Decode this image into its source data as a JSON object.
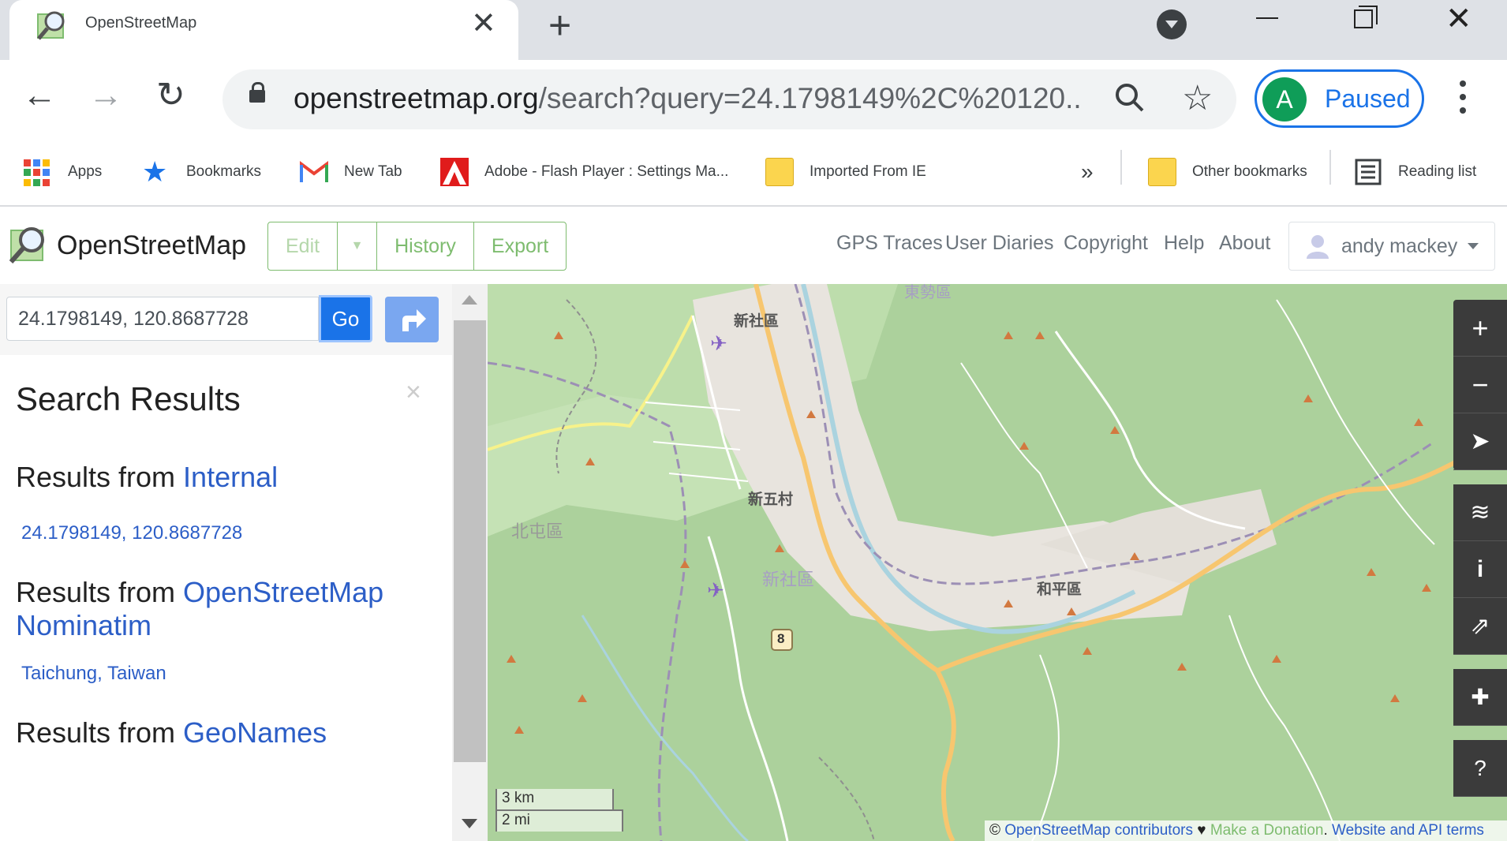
{
  "browser": {
    "tab_title": "OpenStreetMap",
    "url_domain": "openstreetmap.org",
    "url_path": "/search?query=24.1798149%2C%20120....",
    "profile_initial": "A",
    "profile_status": "Paused"
  },
  "bookmarks": [
    {
      "label": "Apps",
      "icon": "apps-grid-icon"
    },
    {
      "label": "Bookmarks",
      "icon": "star-icon"
    },
    {
      "label": "New Tab",
      "icon": "gmail-icon"
    },
    {
      "label": "Adobe - Flash Player : Settings Ma...",
      "icon": "adobe-icon"
    },
    {
      "label": "Imported From IE",
      "icon": "folder-icon"
    },
    {
      "label": "Other bookmarks",
      "icon": "folder-icon"
    },
    {
      "label": "Reading list",
      "icon": "reading-list-icon"
    }
  ],
  "osm": {
    "site_title": "OpenStreetMap",
    "edit_label": "Edit",
    "history_label": "History",
    "export_label": "Export",
    "nav": [
      "GPS Traces",
      "User Diaries",
      "Copyright",
      "Help",
      "About"
    ],
    "user_name": "andy mackey"
  },
  "sidebar": {
    "search_value": "24.1798149, 120.8687728",
    "go_label": "Go",
    "heading": "Search Results",
    "close": "×",
    "sections": [
      {
        "prefix": "Results from ",
        "source": "Internal",
        "result": "24.1798149, 120.8687728"
      },
      {
        "prefix": "Results from ",
        "source": "OpenStreetMap Nominatim",
        "result": "Taichung, Taiwan"
      },
      {
        "prefix": "Results from ",
        "source": "GeoNames",
        "result": ""
      }
    ]
  },
  "map": {
    "labels": [
      "新社區",
      "新五村",
      "北屯區",
      "新社區",
      "和平區",
      "8",
      "東勢區"
    ],
    "scale_km": "3 km",
    "scale_mi": "2 mi",
    "attribution": {
      "copyright": "© ",
      "contributors": "OpenStreetMap contributors",
      "heart": " ♥ ",
      "donation": "Make a Donation",
      "dot": ". ",
      "terms": "Website and API terms"
    },
    "colors": {
      "forest": "#acd19c",
      "grass": "#cde6bd",
      "urban": "#e8e4de",
      "road_major": "#f7c66f",
      "river": "#aad3df",
      "boundary": "#9c8fb5",
      "peak": "#d27940"
    }
  }
}
